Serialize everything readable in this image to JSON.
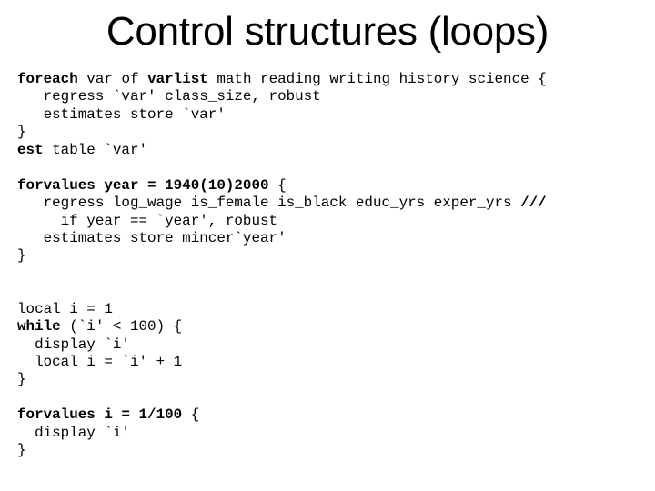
{
  "slide": {
    "title": "Control structures (loops)",
    "code_blocks": [
      {
        "name": "foreach-block",
        "lines": [
          [
            {
              "t": "foreach",
              "b": true
            },
            {
              "t": " var of "
            },
            {
              "t": "varlist",
              "b": true
            },
            {
              "t": " math reading writing history science {"
            }
          ],
          [
            {
              "t": "   regress `var' class_size, robust"
            }
          ],
          [
            {
              "t": "   estimates store `var'"
            }
          ],
          [
            {
              "t": "}"
            }
          ],
          [
            {
              "t": "est",
              "b": true
            },
            {
              "t": " table `var'"
            }
          ]
        ]
      },
      {
        "name": "forvalues-year-block",
        "lines": [
          [
            {
              "t": "forvalues year = 1940(10)2000",
              "b": true
            },
            {
              "t": " {"
            }
          ],
          [
            {
              "t": "   regress log_wage is_female is_black educ_yrs exper_yrs "
            },
            {
              "t": "///",
              "b": true
            }
          ],
          [
            {
              "t": "     if year == `year', robust"
            }
          ],
          [
            {
              "t": "   estimates store mincer`year'"
            }
          ],
          [
            {
              "t": "}"
            }
          ]
        ]
      },
      {
        "name": "while-block",
        "lines": [
          [
            {
              "t": "local i = 1"
            }
          ],
          [
            {
              "t": "while",
              "b": true
            },
            {
              "t": " (`i' < 100) {"
            }
          ],
          [
            {
              "t": "  display `i'"
            }
          ],
          [
            {
              "t": "  local i = `i' + 1"
            }
          ],
          [
            {
              "t": "}"
            }
          ]
        ]
      },
      {
        "name": "forvalues-i-block",
        "lines": [
          [
            {
              "t": "forvalues i = 1/100",
              "b": true
            },
            {
              "t": " {"
            }
          ],
          [
            {
              "t": "  display `i'"
            }
          ],
          [
            {
              "t": "}"
            }
          ]
        ]
      }
    ]
  }
}
